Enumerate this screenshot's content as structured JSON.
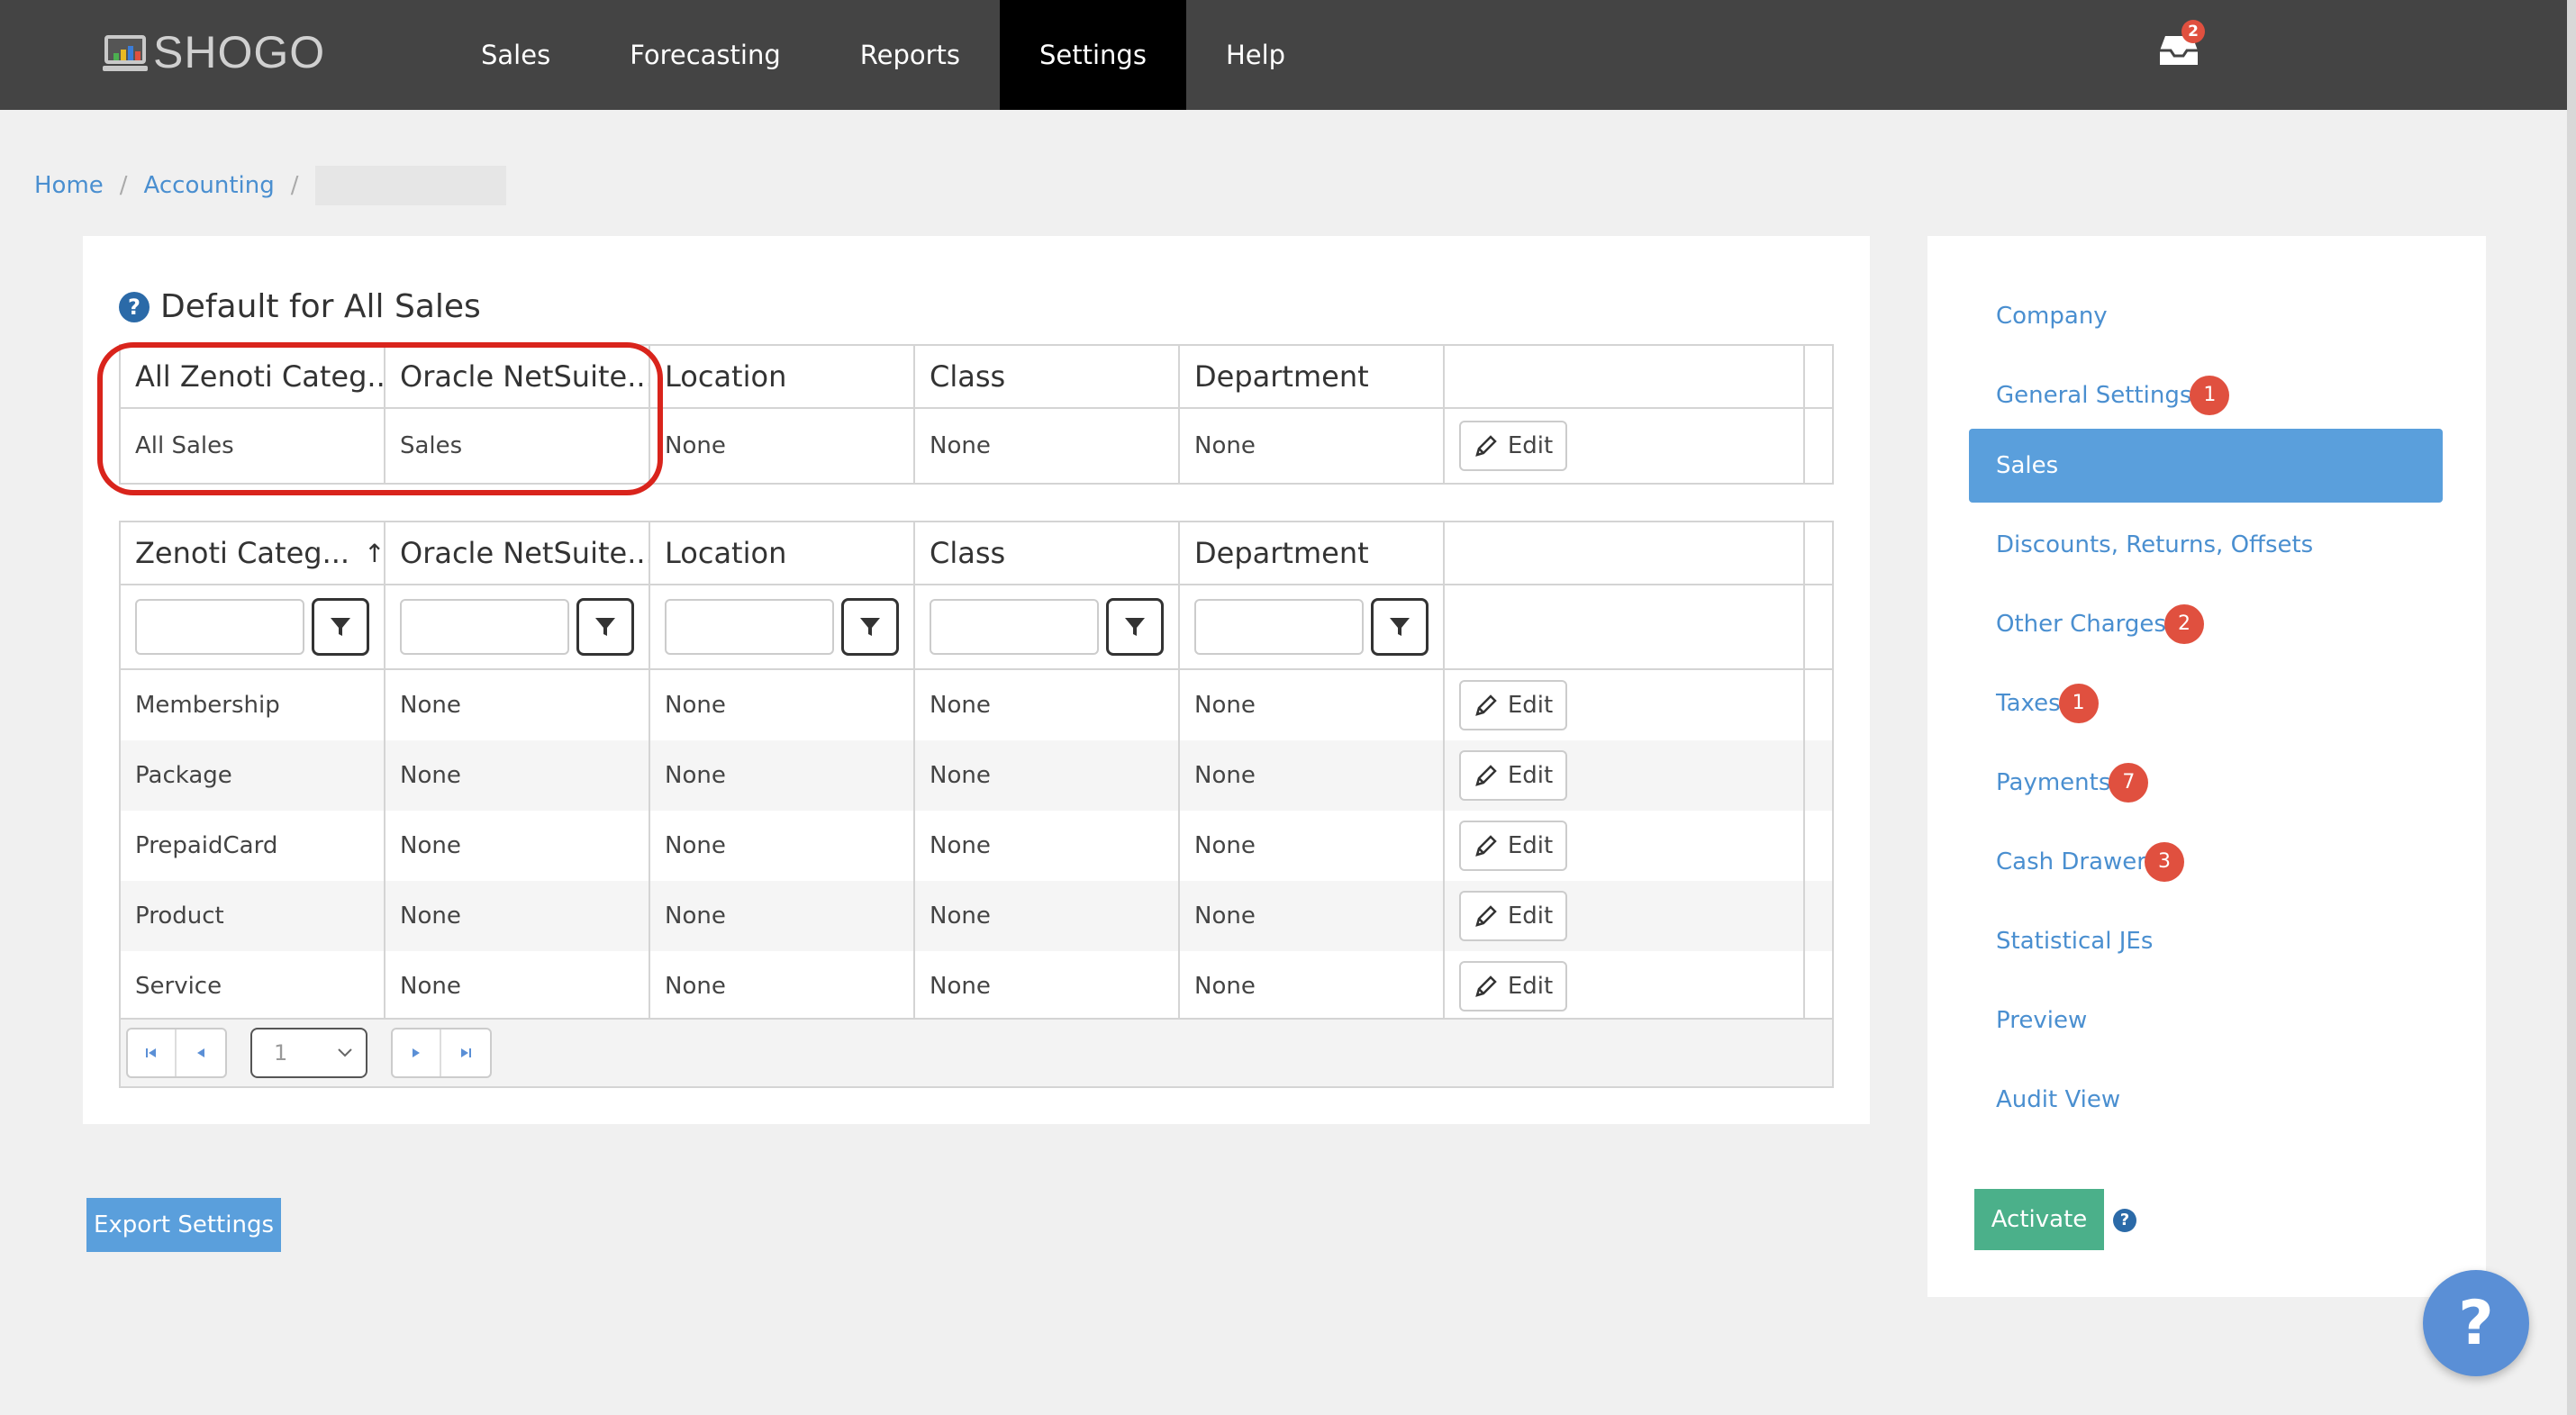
{
  "app": {
    "logo_text": "SHOGO",
    "nav": [
      {
        "label": "Sales"
      },
      {
        "label": "Forecasting"
      },
      {
        "label": "Reports"
      },
      {
        "label": "Settings",
        "active": true
      },
      {
        "label": "Help"
      }
    ],
    "inbox_icon": "inbox-tray-icon",
    "inbox_badge": "2"
  },
  "breadcrumb": {
    "home": "Home",
    "accounting": "Accounting"
  },
  "defaults_section": {
    "title": "Default for All Sales",
    "help_glyph": "?",
    "columns": [
      "All Zenoti Categ...",
      "Oracle NetSuite...",
      "Location",
      "Class",
      "Department"
    ],
    "row": {
      "category": "All Sales",
      "netsuite": "Sales",
      "location": "None",
      "class": "None",
      "department": "None",
      "edit_label": "Edit"
    }
  },
  "categories_grid": {
    "columns": [
      "Zenoti Categ...",
      "Oracle NetSuite...",
      "Location",
      "Class",
      "Department"
    ],
    "sort_glyph": "↑",
    "rows": [
      {
        "category": "Membership",
        "netsuite": "None",
        "location": "None",
        "class": "None",
        "department": "None",
        "edit_label": "Edit"
      },
      {
        "category": "Package",
        "netsuite": "None",
        "location": "None",
        "class": "None",
        "department": "None",
        "edit_label": "Edit"
      },
      {
        "category": "PrepaidCard",
        "netsuite": "None",
        "location": "None",
        "class": "None",
        "department": "None",
        "edit_label": "Edit"
      },
      {
        "category": "Product",
        "netsuite": "None",
        "location": "None",
        "class": "None",
        "department": "None",
        "edit_label": "Edit"
      },
      {
        "category": "Service",
        "netsuite": "None",
        "location": "None",
        "class": "None",
        "department": "None",
        "edit_label": "Edit"
      }
    ],
    "pager": {
      "page": "1"
    }
  },
  "export_button": "Export Settings",
  "sidebar": {
    "items": [
      {
        "label": "Company",
        "badge": ""
      },
      {
        "label": "General Settings",
        "badge": "1"
      },
      {
        "label": "Sales",
        "badge": "",
        "active": true
      },
      {
        "label": "Discounts, Returns, Offsets",
        "badge": ""
      },
      {
        "label": "Other Charges",
        "badge": "2"
      },
      {
        "label": "Taxes",
        "badge": "1"
      },
      {
        "label": "Payments",
        "badge": "7"
      },
      {
        "label": "Cash Drawer",
        "badge": "3"
      },
      {
        "label": "Statistical JEs",
        "badge": ""
      },
      {
        "label": "Preview",
        "badge": ""
      },
      {
        "label": "Audit View",
        "badge": ""
      }
    ],
    "activate_label": "Activate",
    "activate_help": "?"
  },
  "fab_glyph": "?",
  "colors": {
    "topbar": "#444444",
    "link": "#4a8fd0",
    "active_item": "#5a9fdc",
    "badge": "#e0503f",
    "activate": "#4bb08a",
    "highlight": "#d9241c"
  }
}
